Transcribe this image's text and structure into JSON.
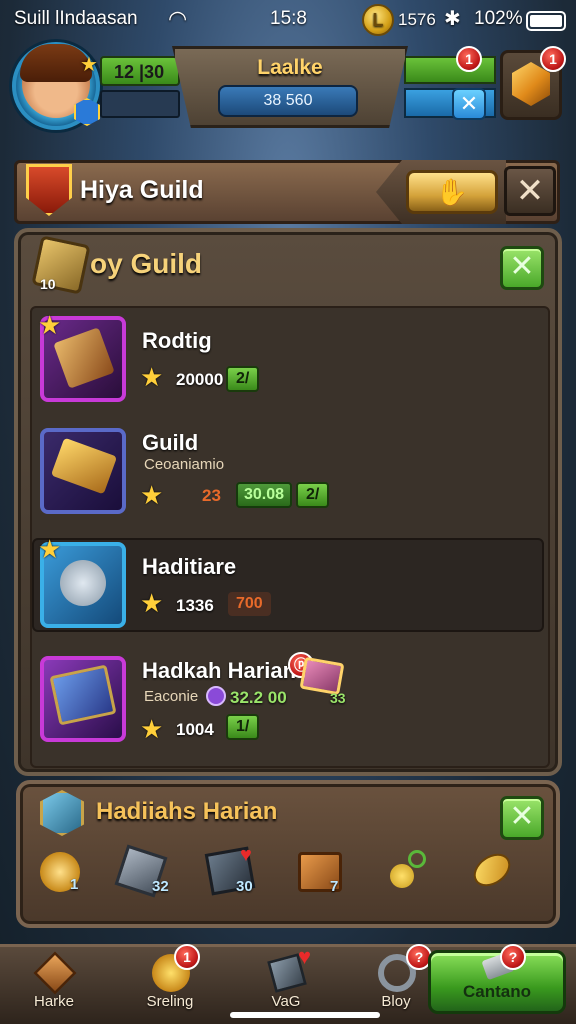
{
  "status": {
    "carrier": "Suill lIndaasan",
    "time": "15:8",
    "coins": "1576",
    "coin_glyph": "L",
    "battery": "102%",
    "wifi_icon": "wifi-icon",
    "bluetooth_icon": "bluetooth-icon"
  },
  "hud": {
    "level": "12 |30",
    "title": "Laalke",
    "title_value": "38 560",
    "badge_count": "1",
    "gem_badge": "1"
  },
  "guild_header": {
    "title": "Hiya Guild"
  },
  "panel": {
    "title": "oy Guild",
    "icon_number": "10"
  },
  "rows": [
    {
      "name": "Rodtig",
      "value": "20000",
      "pill": "2/"
    },
    {
      "name": "Guild",
      "sub": "Ceoaniamio",
      "orange": "23",
      "green_value": "30.08",
      "pill": "2/"
    },
    {
      "name": "Haditiare",
      "value": "1336",
      "dark_pill": "700"
    },
    {
      "name": "Hadkah Harian",
      "sub": "Eaconie",
      "green_value": "32.2 00",
      "extra": "33",
      "value": "1004",
      "pill": "1/"
    }
  ],
  "daily": {
    "title": "Hadiiahs Harian",
    "rewards": [
      {
        "icon": "medal-icon",
        "count": "1"
      },
      {
        "icon": "iron-crate-icon",
        "count": "32"
      },
      {
        "icon": "dark-crate-icon",
        "count": "30"
      },
      {
        "icon": "chest-icon",
        "count": "7"
      },
      {
        "icon": "potion-icon",
        "count": ""
      },
      {
        "icon": "gold-coin-icon",
        "count": ""
      }
    ]
  },
  "nav": {
    "items": [
      {
        "label": "Harke",
        "icon": "crate-icon"
      },
      {
        "label": "Sreling",
        "icon": "coin-icon",
        "badge": "1"
      },
      {
        "label": "VaG",
        "icon": "box-heart-icon"
      },
      {
        "label": "Bloy",
        "icon": "ring-icon",
        "badge": "?"
      }
    ],
    "play_label": "Cantano",
    "play_badge": "?"
  }
}
